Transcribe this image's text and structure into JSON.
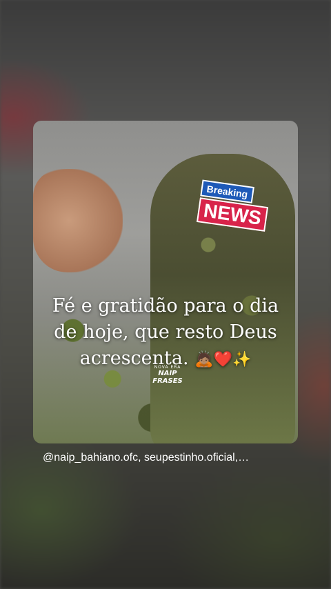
{
  "story": {
    "sticker": {
      "top_label": "Breaking",
      "bottom_label": "NEWS"
    },
    "caption": {
      "line1": "Fé e gratidão para o dia",
      "line2": "de hoje, que resto Deus",
      "line3": "acrescenta.",
      "emoji_bow": "🙇🏽",
      "emoji_heart": "❤️",
      "emoji_sparkles": "✨"
    },
    "watermark": {
      "top": "NOVA ERA",
      "bottom": "NAIP FRASES"
    },
    "mentions": "@naip_bahiano.ofc, seupestinho.oficial,…"
  },
  "colors": {
    "sticker_blue": "#1e5ab8",
    "sticker_red": "#d8234a",
    "text": "#ffffff"
  }
}
